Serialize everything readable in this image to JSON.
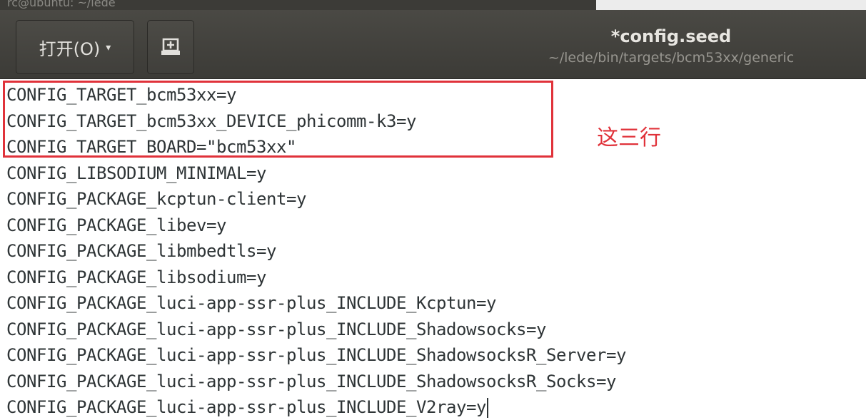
{
  "top_strip": {
    "text": "rc@ubuntu: ~/lede"
  },
  "header": {
    "open_button_label": "打开(O)",
    "open_button_caret": "▾",
    "new_document_icon": "new-document-icon",
    "title": "*config.seed",
    "subtitle": "~/lede/bin/targets/bcm53xx/generic"
  },
  "editor": {
    "lines": [
      "CONFIG_TARGET_bcm53xx=y",
      "CONFIG_TARGET_bcm53xx_DEVICE_phicomm-k3=y",
      "CONFIG_TARGET_BOARD=\"bcm53xx\"",
      "CONFIG_LIBSODIUM_MINIMAL=y",
      "CONFIG_PACKAGE_kcptun-client=y",
      "CONFIG_PACKAGE_libev=y",
      "CONFIG_PACKAGE_libmbedtls=y",
      "CONFIG_PACKAGE_libsodium=y",
      "CONFIG_PACKAGE_luci-app-ssr-plus_INCLUDE_Kcptun=y",
      "CONFIG_PACKAGE_luci-app-ssr-plus_INCLUDE_Shadowsocks=y",
      "CONFIG_PACKAGE_luci-app-ssr-plus_INCLUDE_ShadowsocksR_Server=y",
      "CONFIG_PACKAGE_luci-app-ssr-plus_INCLUDE_ShadowsocksR_Socks=y",
      "CONFIG_PACKAGE_luci-app-ssr-plus_INCLUDE_V2ray=y"
    ]
  },
  "annotation": {
    "text": "这三行",
    "color": "#e0323a"
  },
  "colors": {
    "headerbar": "#3c3b37",
    "editor_text": "#2e3436",
    "highlight": "#e0323a"
  }
}
